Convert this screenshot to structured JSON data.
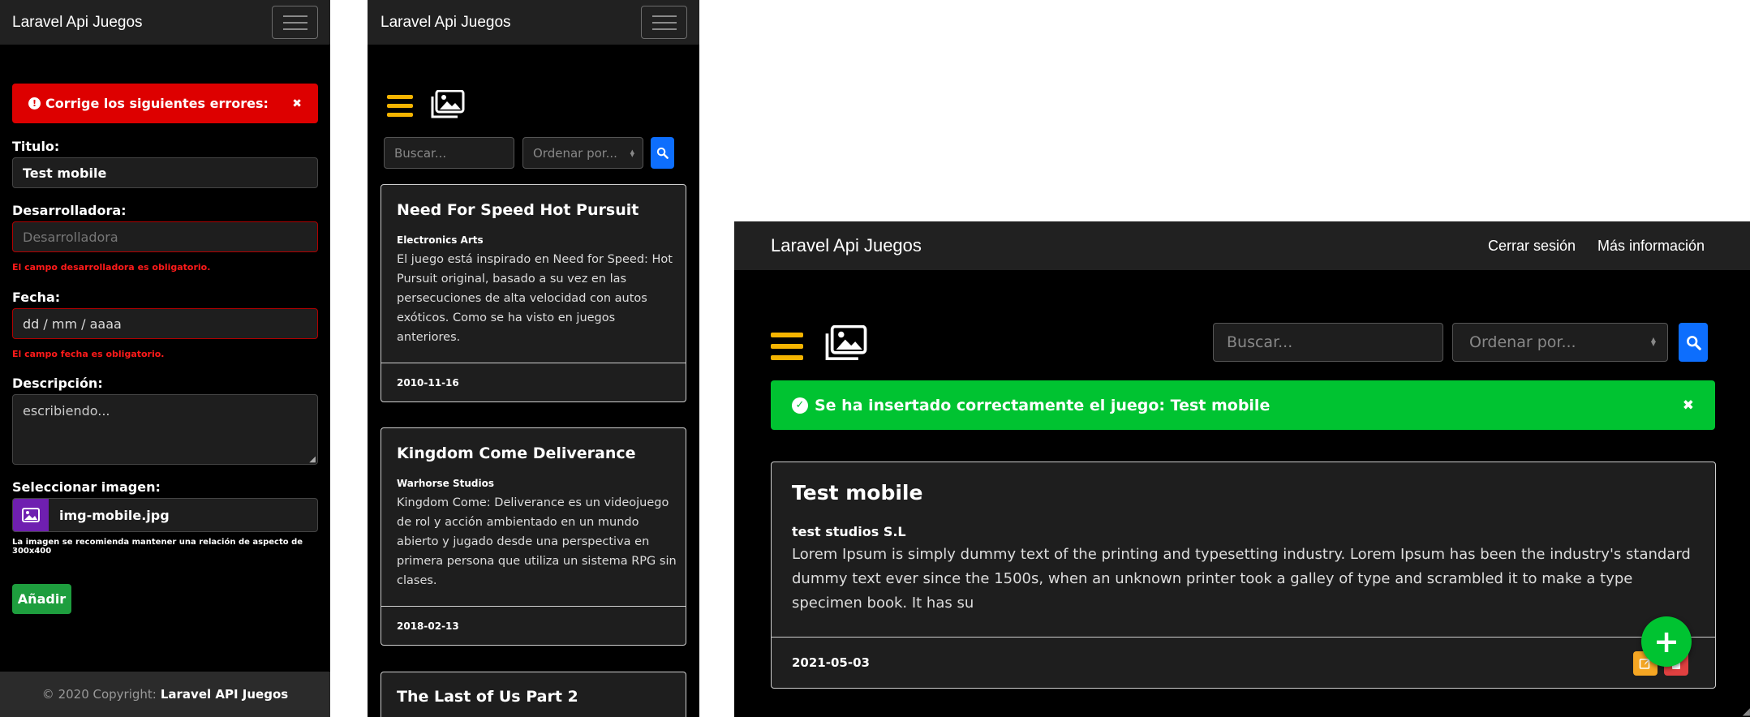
{
  "app_title": "Laravel Api Juegos",
  "form_panel": {
    "alert": {
      "text": "Corrige los siguientes errores:",
      "close": "✖"
    },
    "titulo": {
      "label": "Titulo:",
      "value": "Test mobile"
    },
    "desarrolladora": {
      "label": "Desarrolladora:",
      "placeholder": "Desarrolladora",
      "error": "El campo desarrolladora es obligatorio."
    },
    "fecha": {
      "label": "Fecha:",
      "value": "dd / mm / aaaa",
      "error": "El campo fecha es obligatorio."
    },
    "descripcion": {
      "label": "Descripción:",
      "value": "escribiendo..."
    },
    "imagen": {
      "label": "Seleccionar imagen:",
      "filename": "img-mobile.jpg",
      "hint": "La imagen se recomienda mantener una relación de aspecto de 300x400"
    },
    "submit_label": "Añadir",
    "footer": {
      "prefix": "© 2020 Copyright:",
      "strong": "Laravel API Juegos"
    }
  },
  "list_panel": {
    "search_placeholder": "Buscar...",
    "sort_placeholder": "Ordenar por...",
    "cards": [
      {
        "title": "Need For Speed Hot Pursuit",
        "developer": "Electronics Arts",
        "description": "El juego está inspirado en Need for Speed: Hot Pursuit original, basado a su vez en las persecuciones de alta velocidad con autos exóticos. Como se ha visto en juegos anteriores.",
        "date": "2010-11-16"
      },
      {
        "title": "Kingdom Come Deliverance",
        "developer": "Warhorse Studios",
        "description": "Kingdom Come: Deliverance es un videojuego de rol y acción ambientado en un mundo abierto y jugado desde una perspectiva en primera persona que utiliza un sistema RPG sin clases.",
        "date": "2018-02-13"
      },
      {
        "title": "The Last of Us Part 2"
      }
    ]
  },
  "desktop_panel": {
    "nav_links": [
      "Cerrar sesión",
      "Más información"
    ],
    "search_placeholder": "Buscar...",
    "sort_placeholder": "Ordenar por...",
    "success_alert": {
      "text": "Se ha insertado correctamente el juego: Test mobile",
      "close": "✖"
    },
    "card": {
      "title": "Test mobile",
      "developer": "test studios S.L",
      "description": "Lorem Ipsum is simply dummy text of the printing and typesetting industry. Lorem Ipsum has been the industry's standard dummy text ever since the 1500s, when an unknown printer took a galley of type and scrambled it to make a type specimen book. It has su",
      "date": "2021-05-03"
    },
    "fab_symbol": "+"
  },
  "colors": {
    "danger": "#dd0000",
    "success": "#00c331",
    "primary": "#0d6efd",
    "accent": "#f5b400",
    "purple": "#6f1fb0",
    "green_btn": "#1e9e3e"
  },
  "icons": [
    "exclamation-circle-icon",
    "close-icon",
    "image-icon",
    "hamburger-icon",
    "gallery-icon",
    "search-icon",
    "check-circle-icon",
    "edit-icon",
    "delete-icon",
    "plus-icon"
  ]
}
